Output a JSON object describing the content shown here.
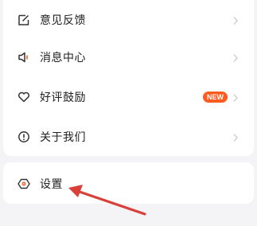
{
  "menu": {
    "items": [
      {
        "label": "意见反馈",
        "icon": "feedback-edit-icon"
      },
      {
        "label": "消息中心",
        "icon": "speaker-icon"
      },
      {
        "label": "好评鼓励",
        "icon": "heart-icon",
        "badge": "NEW"
      },
      {
        "label": "关于我们",
        "icon": "info-circle-icon"
      }
    ]
  },
  "settings": {
    "label": "设置",
    "icon": "settings-hexagon-icon"
  },
  "colors": {
    "text": "#222222",
    "icon": "#333333",
    "chevron": "#c8c8c8",
    "badge": "#ff5a1f",
    "annotation_arrow": "#d9403a",
    "background": "#f4f4f6"
  }
}
